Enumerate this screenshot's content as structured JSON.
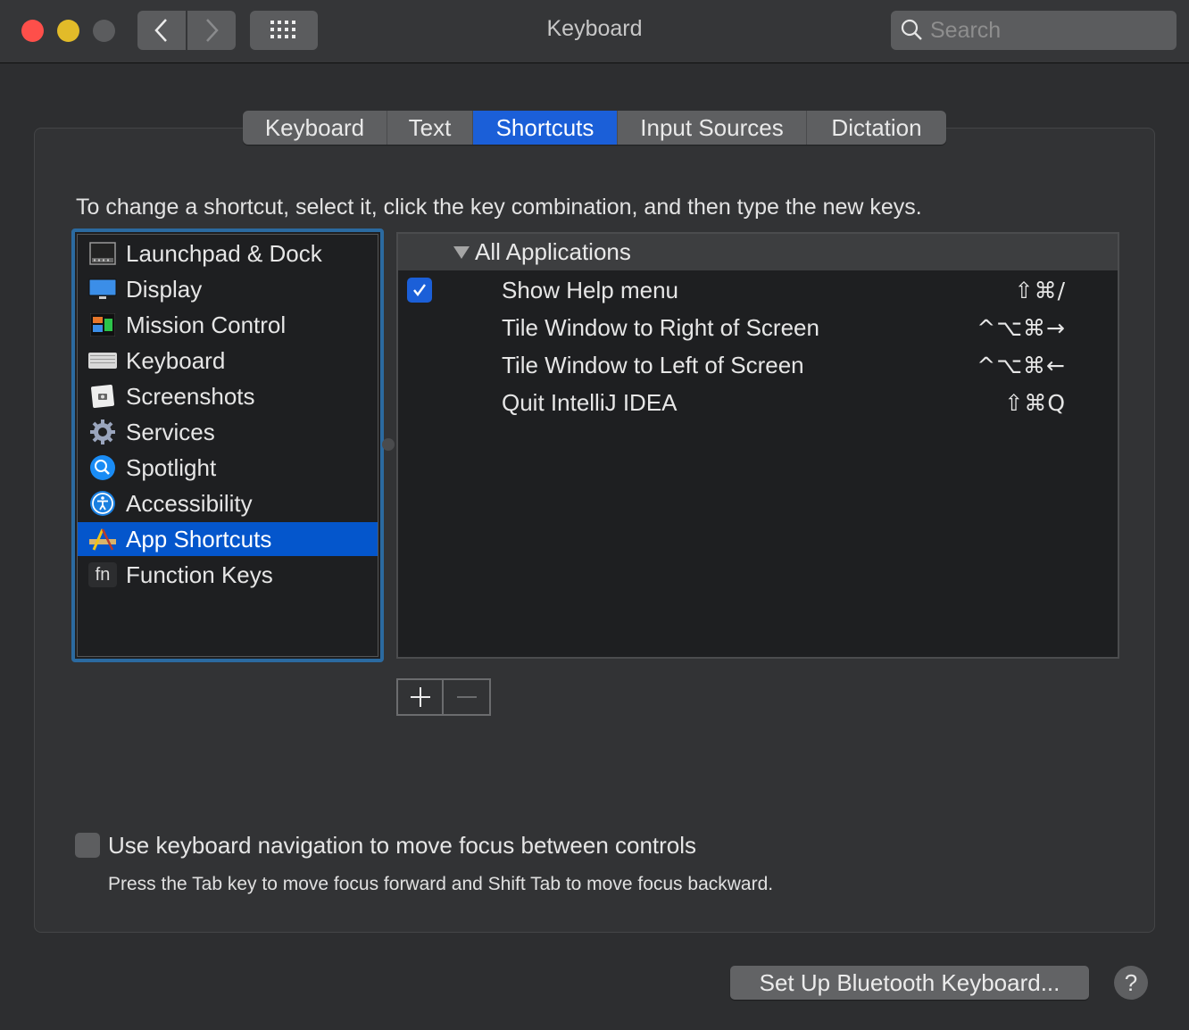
{
  "window": {
    "title": "Keyboard",
    "search_placeholder": "Search"
  },
  "tabs": [
    {
      "label": "Keyboard",
      "active": false
    },
    {
      "label": "Text",
      "active": false
    },
    {
      "label": "Shortcuts",
      "active": true
    },
    {
      "label": "Input Sources",
      "active": false
    },
    {
      "label": "Dictation",
      "active": false
    }
  ],
  "instruction": "To change a shortcut, select it, click the key combination, and then type the new keys.",
  "categories": [
    {
      "label": "Launchpad & Dock",
      "icon": "launchpad-dock-icon",
      "selected": false
    },
    {
      "label": "Display",
      "icon": "display-icon",
      "selected": false
    },
    {
      "label": "Mission Control",
      "icon": "mission-control-icon",
      "selected": false
    },
    {
      "label": "Keyboard",
      "icon": "keyboard-icon",
      "selected": false
    },
    {
      "label": "Screenshots",
      "icon": "screenshots-icon",
      "selected": false
    },
    {
      "label": "Services",
      "icon": "gear-icon",
      "selected": false
    },
    {
      "label": "Spotlight",
      "icon": "spotlight-icon",
      "selected": false
    },
    {
      "label": "Accessibility",
      "icon": "accessibility-icon",
      "selected": false
    },
    {
      "label": "App Shortcuts",
      "icon": "app-shortcuts-icon",
      "selected": true
    },
    {
      "label": "Function Keys",
      "icon": "fn-icon",
      "selected": false
    }
  ],
  "fn_icon_text": "fn",
  "shortcuts": {
    "group_label": "All Applications",
    "rows": [
      {
        "name": "Show Help menu",
        "keys": "⇧⌘/",
        "checked": true
      },
      {
        "name": "Tile Window to Right of Screen",
        "keys": "^⌥⌘→",
        "checked": false
      },
      {
        "name": "Tile Window to Left of Screen",
        "keys": "^⌥⌘←",
        "checked": false
      },
      {
        "name": "Quit IntelliJ IDEA",
        "keys": "⇧⌘Q",
        "checked": false
      }
    ]
  },
  "keyboard_navigation": {
    "label": "Use keyboard navigation to move focus between controls",
    "hint": "Press the Tab key to move focus forward and Shift Tab to move focus backward.",
    "checked": false
  },
  "buttons": {
    "bluetooth": "Set Up Bluetooth Keyboard...",
    "help": "?"
  },
  "colors": {
    "accent": "#1b5fd8",
    "selection": "#0456cc",
    "focus_ring": "#2b6aa0"
  }
}
